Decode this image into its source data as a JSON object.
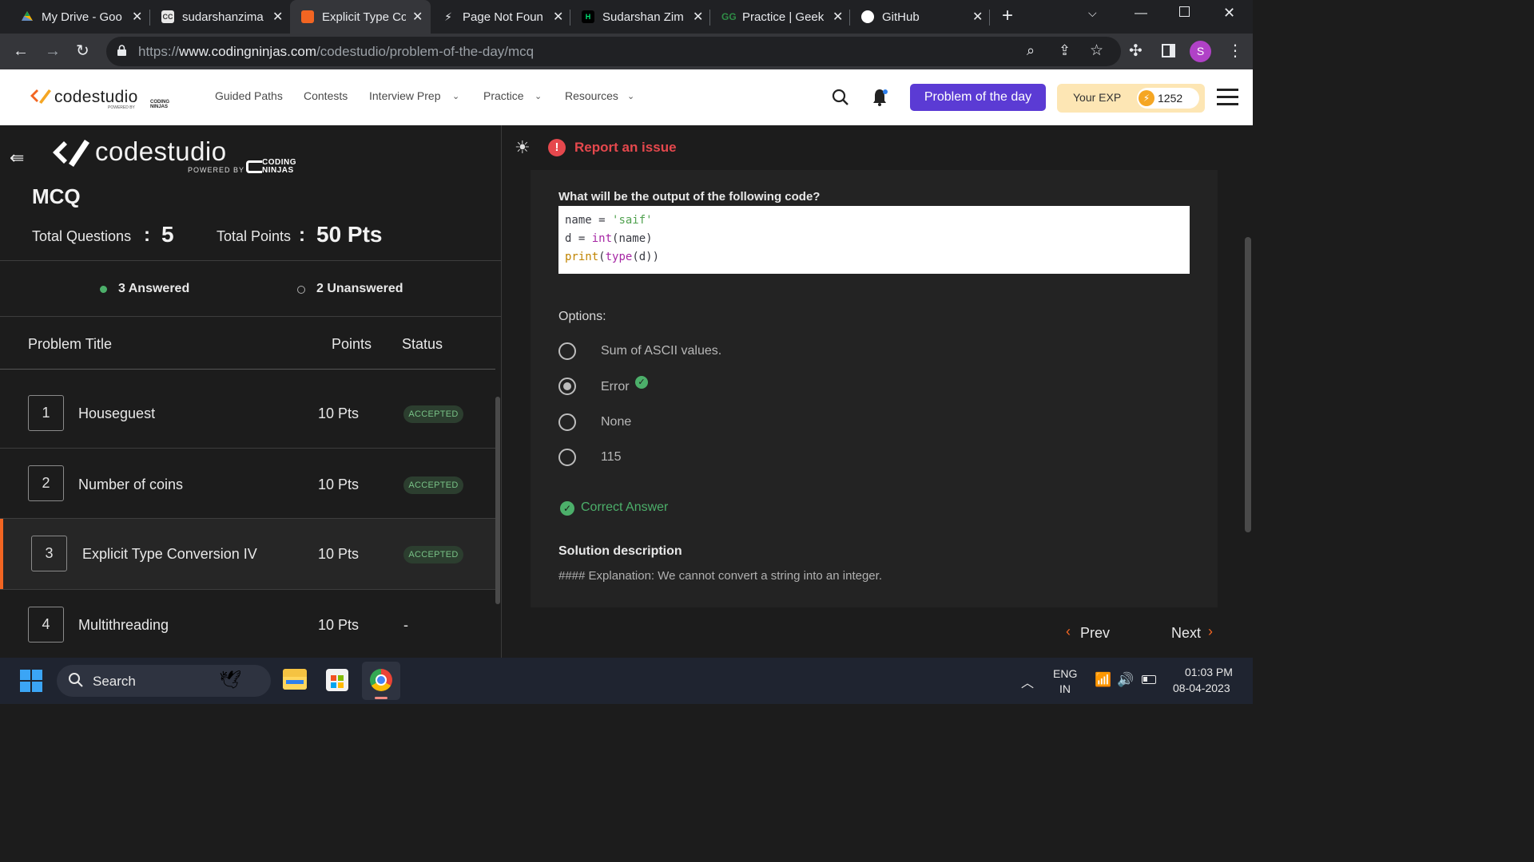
{
  "browser": {
    "tabs": [
      {
        "title": "My Drive - Goo",
        "favicon_color": "#f4b400"
      },
      {
        "title": "sudarshanzima",
        "favicon_color": "#555555"
      },
      {
        "title": "Explicit Type Co",
        "favicon_color": "#f26522"
      },
      {
        "title": "Page Not Foun",
        "favicon_color": "#ffffff"
      },
      {
        "title": "Sudarshan Zim",
        "favicon_color": "#ffffff"
      },
      {
        "title": "Practice | Geek",
        "favicon_color": "#2f8d46"
      },
      {
        "title": "GitHub",
        "favicon_color": "#ffffff"
      }
    ],
    "url_prefix": "https://",
    "url_host": "www.codingninjas.com",
    "url_path": "/codestudio/problem-of-the-day/mcq",
    "profile_initial": "S"
  },
  "site_nav": {
    "brand": "codestudio",
    "brand_sub": "POWERED BY",
    "brand_partner": "CODING NINJAS",
    "links": [
      "Guided Paths",
      "Contests",
      "Interview Prep",
      "Practice",
      "Resources"
    ],
    "potd_label": "Problem of the day",
    "exp_label": "Your EXP",
    "exp_value": "1252"
  },
  "left_panel": {
    "brand": "codestudio",
    "brand_sub": "POWERED BY",
    "brand_partner_line1": "CODING",
    "brand_partner_line2": "NINJAS",
    "heading": "MCQ",
    "total_questions_label": "Total Questions",
    "total_questions_value": "5",
    "total_points_label": "Total Points",
    "total_points_value": "50 Pts",
    "sep": ":",
    "answered": "3 Answered",
    "unanswered": "2 Unanswered",
    "col_title": "Problem Title",
    "col_points": "Points",
    "col_status": "Status",
    "problems": [
      {
        "num": "1",
        "title": "Houseguest",
        "points": "10 Pts",
        "status": "ACCEPTED"
      },
      {
        "num": "2",
        "title": "Number of coins",
        "points": "10 Pts",
        "status": "ACCEPTED"
      },
      {
        "num": "3",
        "title": "Explicit Type Conversion IV",
        "points": "10 Pts",
        "status": "ACCEPTED"
      },
      {
        "num": "4",
        "title": "Multithreading",
        "points": "10 Pts",
        "status": "-"
      }
    ]
  },
  "right_panel": {
    "report": "Report an issue",
    "question": "What will be the output of the following code?",
    "code_line1_var": "name",
    "code_line1_op": " = ",
    "code_line1_str": "'saif'",
    "code_line2_var": "d = ",
    "code_line2_fn": "int",
    "code_line2_rest": "(name)",
    "code_line3_fn": "print",
    "code_line3_paren": "(",
    "code_line3_fn2": "type",
    "code_line3_rest": "(d))",
    "options_label": "Options:",
    "options": [
      "Sum of ASCII values.",
      "Error",
      "None",
      "115"
    ],
    "correct_answer": "Correct Answer",
    "solution_heading": "Solution description",
    "solution_text": "#### Explanation: We cannot convert a string into an integer.",
    "prev": "Prev",
    "next": "Next"
  },
  "taskbar": {
    "search": "Search",
    "lang1": "ENG",
    "lang2": "IN",
    "time": "01:03 PM",
    "date": "08-04-2023"
  },
  "colors": {
    "accent_purple": "#5b3bd4",
    "accent_orange": "#f26522",
    "report_red": "#e5484d",
    "success_green": "#4caf6a"
  }
}
